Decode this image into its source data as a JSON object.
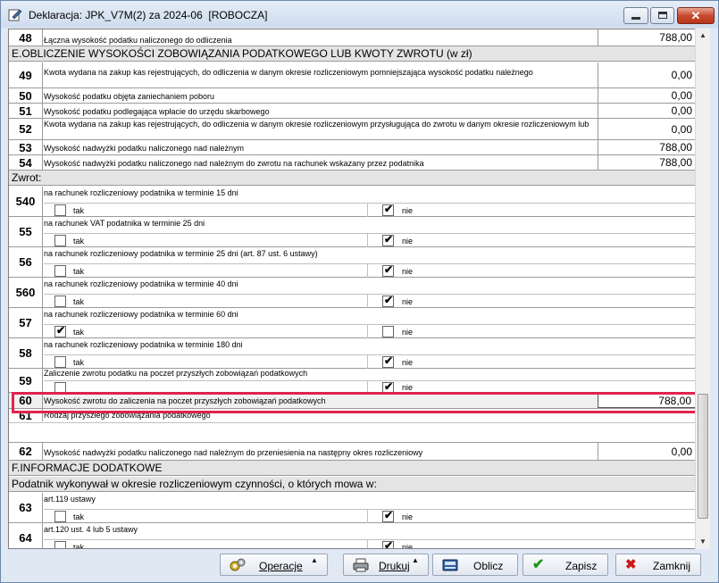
{
  "window": {
    "title": "Deklaracja: JPK_V7M(2) za 2024-06  [ROBOCZA]"
  },
  "rows": {
    "r48": {
      "num": "48",
      "label": "Łączna wysokość podatku naliczonego do odliczenia",
      "value": "788,00"
    },
    "sectionE": "E.OBLICZENIE WYSOKOŚCI ZOBOWIĄZANIA PODATKOWEGO LUB KWOTY ZWROTU (w zł)",
    "r49": {
      "num": "49",
      "label": "Kwota wydana na zakup kas rejestrujących, do odliczenia w danym okresie rozliczeniowym pomniejszająca wysokość podatku należnego",
      "value": "0,00"
    },
    "r50": {
      "num": "50",
      "label": "Wysokość podatku objęta zaniechaniem poboru",
      "value": "0,00"
    },
    "r51": {
      "num": "51",
      "label": "Wysokość podatku podlegająca wpłacie do urzędu skarbowego",
      "value": "0,00"
    },
    "r52": {
      "num": "52",
      "label": "Kwota wydana na zakup kas rejestrujących, do odliczenia w danym okresie rozliczeniowym przysługująca do zwrotu w danym okresie rozliczeniowym lub",
      "value": "0,00"
    },
    "r53": {
      "num": "53",
      "label": "Wysokość nadwyżki podatku naliczonego nad należnym",
      "value": "788,00"
    },
    "r54": {
      "num": "54",
      "label": "Wysokość nadwyżki podatku naliczonego nad należnym do zwrotu na rachunek wskazany przez podatnika",
      "value": "788,00"
    },
    "zwrot": "Zwrot:",
    "r540": {
      "num": "540",
      "label": "na rachunek rozliczeniowy podatnika w terminie 15 dni",
      "tak": false,
      "nie": true
    },
    "r55": {
      "num": "55",
      "label": "na rachunek VAT podatnika w terminie 25 dni",
      "tak": false,
      "nie": true
    },
    "r56": {
      "num": "56",
      "label": "na rachunek rozliczeniowy podatnika w terminie 25 dni (art. 87 ust. 6 ustawy)",
      "tak": false,
      "nie": true
    },
    "r560": {
      "num": "560",
      "label": "na rachunek rozliczeniowy podatnika w terminie 40 dni",
      "tak": false,
      "nie": true
    },
    "r57": {
      "num": "57",
      "label": "na rachunek rozliczeniowy podatnika w terminie 60 dni",
      "tak": true,
      "nie": false
    },
    "r58": {
      "num": "58",
      "label": "na rachunek rozliczeniowy podatnika w terminie 180 dni",
      "tak": false,
      "nie": true
    },
    "r59": {
      "num": "59",
      "label": "Zaliczenie zwrotu podatku na poczet przyszłych zobowiązań podatkowych",
      "tak": false,
      "nie": true
    },
    "r60": {
      "num": "60",
      "label": "Wysokość zwrotu do zaliczenia na poczet przyszłych zobowiązań podatkowych",
      "value": "788,00"
    },
    "r61": {
      "num": "61",
      "label": "Rodzaj przyszłego zobowiązania podatkowego",
      "value": ""
    },
    "r62": {
      "num": "62",
      "label": "Wysokość nadwyżki podatku naliczonego nad należnym do przeniesienia na następny okres rozliczeniowy",
      "value": "0,00"
    },
    "sectionF": "F.INFORMACJE DODATKOWE",
    "podatnik": "Podatnik wykonywał w okresie rozliczeniowym czynności, o których mowa w:",
    "r63": {
      "num": "63",
      "label": "art.119 ustawy",
      "tak": false,
      "nie": true
    },
    "r64": {
      "num": "64",
      "label": "art.120 ust. 4 lub 5 ustawy",
      "tak": false,
      "nie": true
    }
  },
  "checkbox_labels": {
    "tak": "tak",
    "nie": "nie"
  },
  "buttons": {
    "operacje": "Operacje",
    "drukuj": "Drukuj",
    "oblicz": "Oblicz",
    "zapisz": "Zapisz",
    "zamknij": "Zamknij"
  },
  "colors": {
    "highlight": "#e0234f",
    "section_bg": "#e4e4e4"
  }
}
